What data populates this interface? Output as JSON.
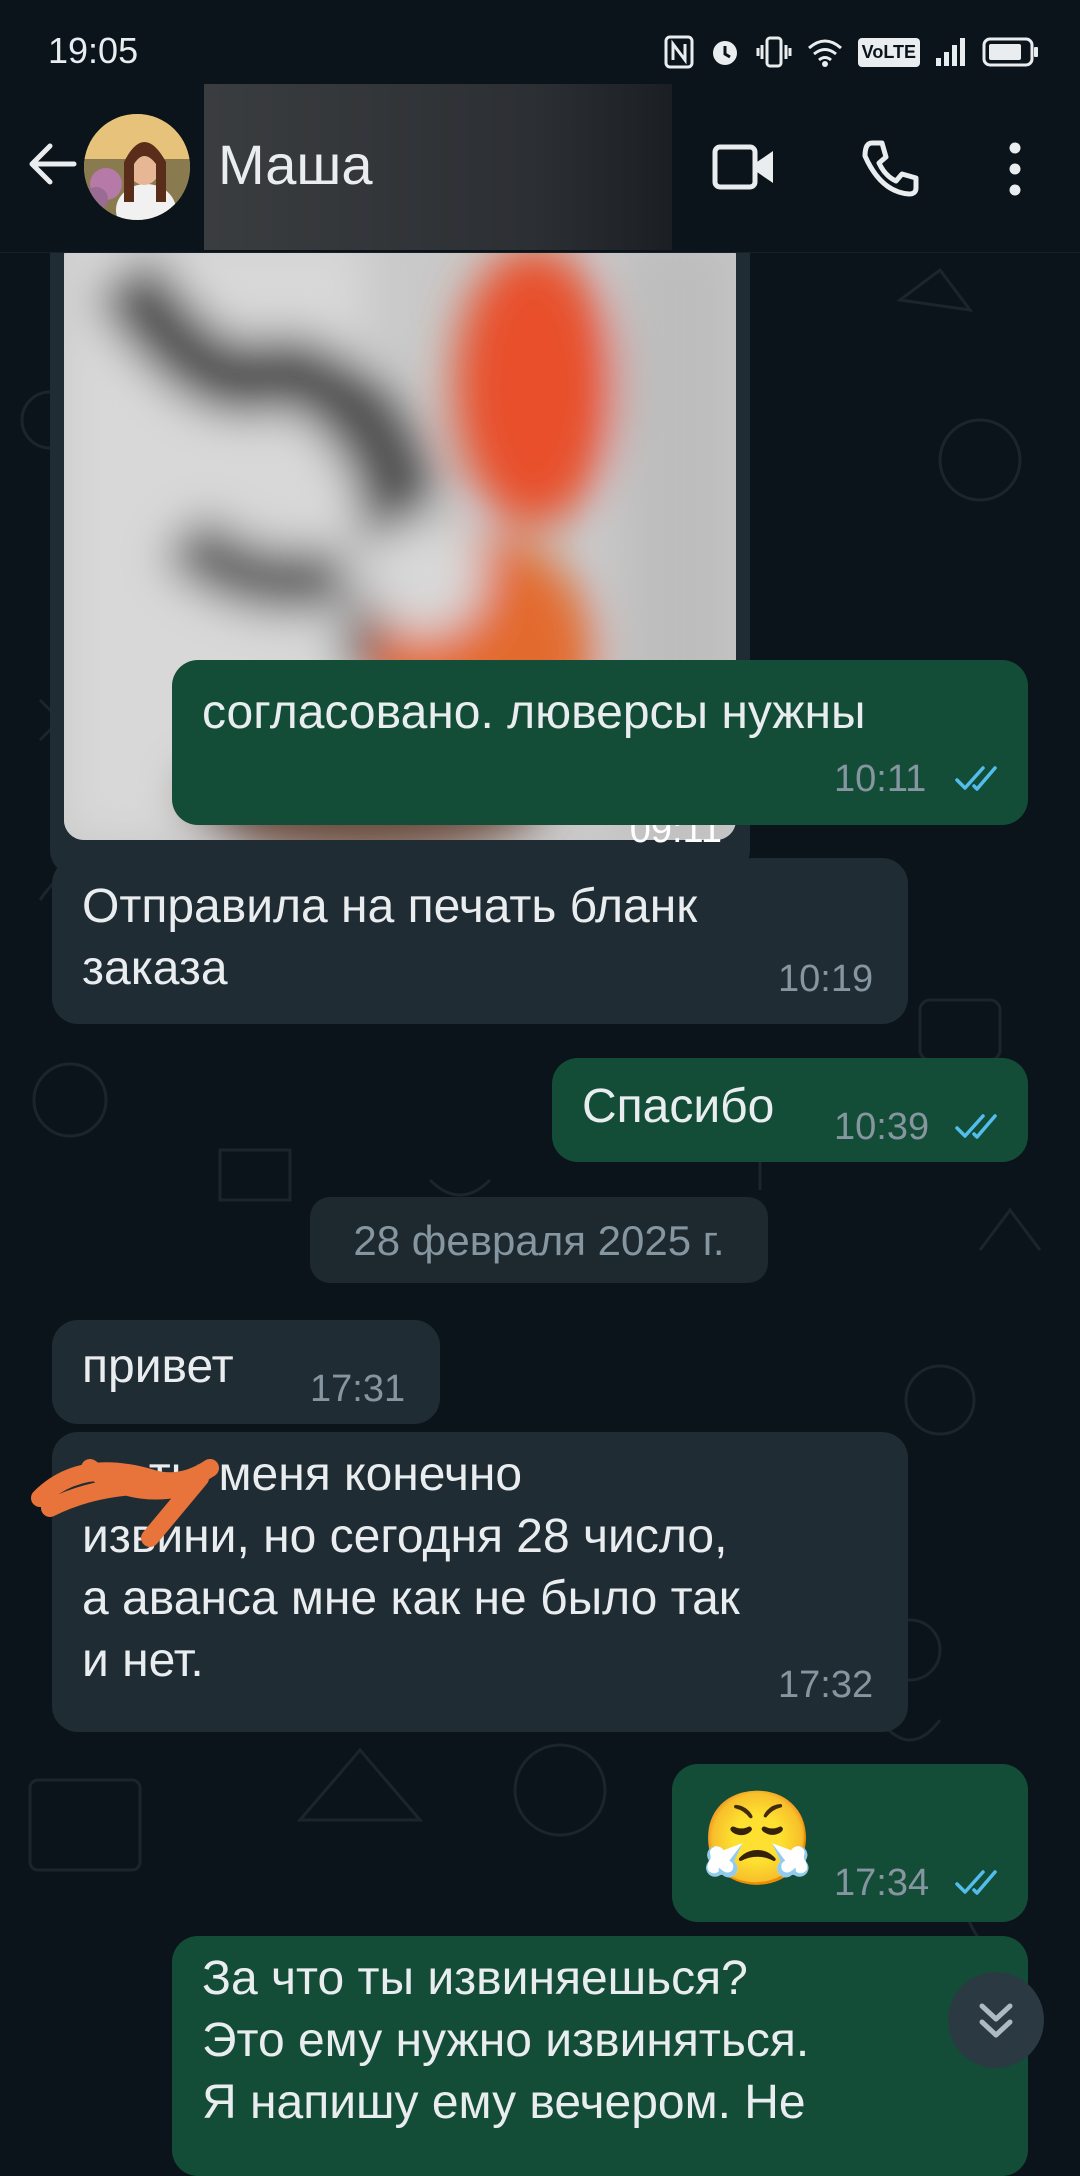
{
  "status_bar": {
    "time": "19:05",
    "volte": "VoLTE"
  },
  "header": {
    "contact_name": "Маша"
  },
  "messages": [
    {
      "dir": "in",
      "type": "photo",
      "time": "09:11"
    },
    {
      "dir": "out",
      "text": "согласовано. люверсы нужны",
      "time": "10:11",
      "read": true
    },
    {
      "dir": "in",
      "text": "Отправила на печать бланк\nзаказа",
      "time": "10:19"
    },
    {
      "dir": "out",
      "text": "Спасибо",
      "time": "10:39",
      "read": true
    },
    {
      "dir": "in",
      "text": "привет",
      "time": "17:31"
    },
    {
      "dir": "in",
      "text": "     ты меня конечно\nизвини, но сегодня 28 число,\nа аванса мне как не было так\nи нет.",
      "time": "17:32"
    },
    {
      "dir": "out",
      "type": "emoji",
      "text": "😤",
      "time": "17:34",
      "read": true
    },
    {
      "dir": "out",
      "text": "За что ты извиняешься?\nЭто ему нужно извиняться.\nЯ напишу ему вечером. Не",
      "time": ""
    }
  ],
  "date_separator": "28 февраля 2025 г.",
  "colors": {
    "incoming": "#202c33",
    "outgoing": "#144d37",
    "background": "#0b141a",
    "read_ticks": "#53bdeb"
  }
}
